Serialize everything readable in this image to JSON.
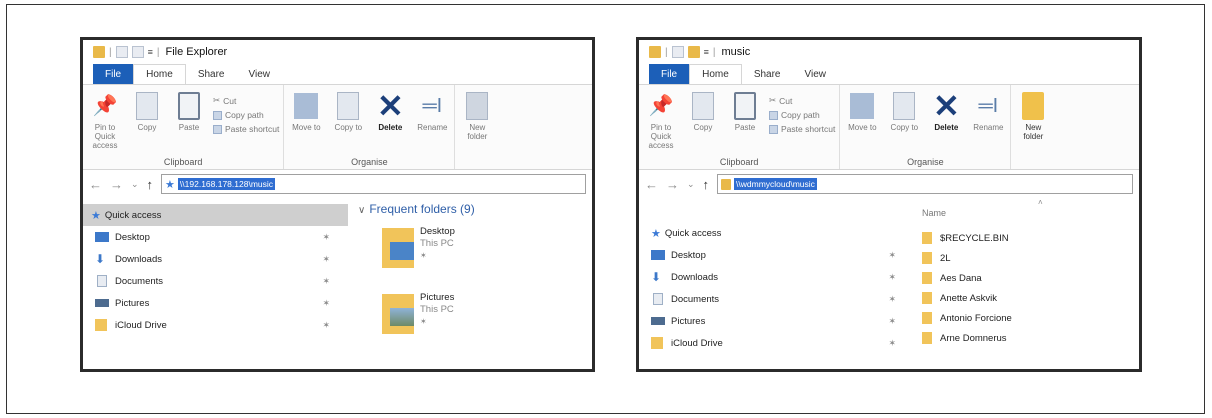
{
  "left": {
    "title": "File Explorer",
    "tabs": [
      "File",
      "Home",
      "Share",
      "View"
    ],
    "ribbon": {
      "pin": "Pin to Quick access",
      "copy": "Copy",
      "paste": "Paste",
      "cut": "Cut",
      "copy_path": "Copy path",
      "paste_shortcut": "Paste shortcut",
      "clipboard": "Clipboard",
      "move_to": "Move to",
      "copy_to": "Copy to",
      "delete": "Delete",
      "rename": "Rename",
      "organise": "Organise",
      "new_folder": "New folder"
    },
    "address": "\\\\192.168.178.128\\music",
    "nav": [
      "Quick access",
      "Desktop",
      "Downloads",
      "Documents",
      "Pictures",
      "iCloud Drive"
    ],
    "frequent_header": "Frequent folders (9)",
    "tiles": [
      {
        "name": "Desktop",
        "sub": "This PC"
      },
      {
        "name": "Pictures",
        "sub": "This PC"
      }
    ]
  },
  "right": {
    "title": "music",
    "tabs": [
      "File",
      "Home",
      "Share",
      "View"
    ],
    "ribbon": {
      "pin": "Pin to Quick access",
      "copy": "Copy",
      "paste": "Paste",
      "cut": "Cut",
      "copy_path": "Copy path",
      "paste_shortcut": "Paste shortcut",
      "clipboard": "Clipboard",
      "move_to": "Move to",
      "copy_to": "Copy to",
      "delete": "Delete",
      "rename": "Rename",
      "organise": "Organise",
      "new_folder": "New folder"
    },
    "address": "\\\\wdmmycloud\\music",
    "nav": [
      "Quick access",
      "Desktop",
      "Downloads",
      "Documents",
      "Pictures",
      "iCloud Drive"
    ],
    "column_header": "Name",
    "files": [
      "$RECYCLE.BIN",
      "2L",
      "Aes Dana",
      "Anette Askvik",
      "Antonio Forcione",
      "Arne Domnerus"
    ]
  }
}
